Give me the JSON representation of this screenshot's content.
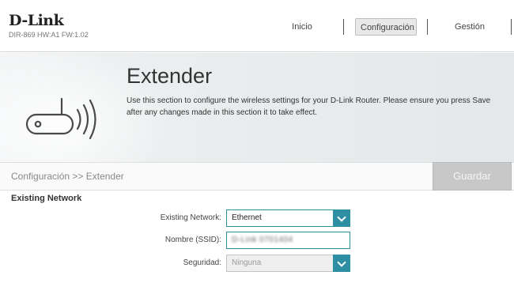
{
  "header": {
    "logo": "D-Link",
    "model": "DIR-869 HW:A1 FW:1.02",
    "nav": [
      {
        "label": "Inicio",
        "active": false
      },
      {
        "label": "Configuración",
        "active": true
      },
      {
        "label": "Gestión",
        "active": false
      }
    ]
  },
  "banner": {
    "title": "Extender",
    "description": "Use this section to configure the wireless settings for your D-Link Router. Please ensure you press Save after any changes made in this section it to take effect.",
    "icon": "extender-router-icon"
  },
  "breadcrumb": "Configuración >> Extender",
  "toolbar": {
    "save_label": "Guardar"
  },
  "section": {
    "title": "Existing Network",
    "fields": {
      "existing_network": {
        "label": "Existing Network:",
        "value": "Ethernet"
      },
      "ssid": {
        "label": "Nombre (SSID):",
        "value": "D-Link 0701404"
      },
      "security": {
        "label": "Seguridad:",
        "value": "Ninguna",
        "disabled": true
      }
    }
  },
  "colors": {
    "accent": "#2e8fa3",
    "save_disabled": "#c8c8c8"
  }
}
